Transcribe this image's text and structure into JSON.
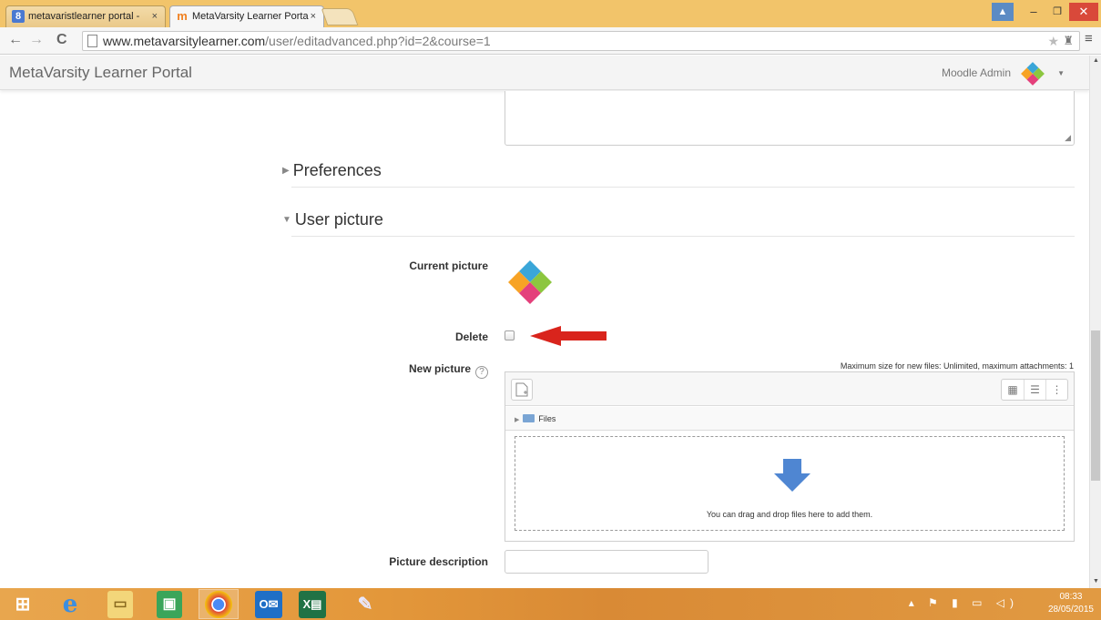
{
  "browser": {
    "tabs": [
      {
        "label": "metavaristlearner portal -",
        "close": "×",
        "icon": "google-icon",
        "color": "#4a79d1"
      },
      {
        "label": "MetaVarsity Learner Porta",
        "close": "×",
        "icon": "moodle-icon",
        "color": "#f08020"
      }
    ],
    "url_host": "www.metavarsitylearner.com",
    "url_path": "/user/editadvanced.php?id=2&course=1",
    "window_controls": {
      "minimize": "–",
      "restore": "❐",
      "close": "✕"
    }
  },
  "header": {
    "site_name": "MetaVarsity Learner Portal",
    "user_name": "Moodle Admin"
  },
  "form": {
    "preferences_label": "Preferences",
    "user_picture_label": "User picture",
    "current_picture_label": "Current picture",
    "delete_label": "Delete",
    "delete_checked": false,
    "new_picture_label": "New picture",
    "help_glyph": "?",
    "max_size_text": "Maximum size for new files: Unlimited, maximum attachments: 1",
    "files_label": "Files",
    "drop_text": "You can drag and drop files here to add them.",
    "picture_description_label": "Picture description",
    "picture_description_value": ""
  },
  "taskbar": {
    "time": "08:33",
    "date": "28/05/2015"
  },
  "colors": {
    "titlebar": "#f2c46a",
    "taskbar": "#e3973a",
    "accent_arrow": "#d9241c",
    "drop_arrow": "#4f86d2"
  }
}
